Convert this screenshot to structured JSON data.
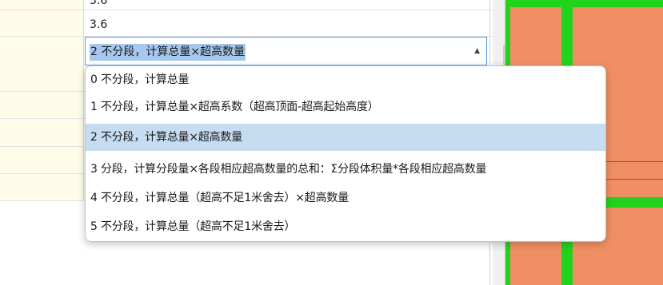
{
  "grid": {
    "top_value": "3.6",
    "value_row": "3.6",
    "combo_value": "2 不分段，计算总量×超高数量"
  },
  "dropdown": {
    "options": [
      "0 不分段，计算总量",
      "1 不分段，计算总量×超高系数（超高顶面-超高起始高度）",
      "2 不分段，计算总量×超高数量",
      "3 分段，计算分段量×各段相应超高数量的总和：Σ分段体积量*各段相应超高数量",
      "4 不分段，计算总量（超高不足1米舍去）×超高数量",
      "5 不分段，计算总量（超高不足1米舍去）"
    ],
    "selected_index": 2
  },
  "colors": {
    "selection": "#c5dcf1",
    "combo_border": "#5b9be0",
    "canvas_fill": "#f08f63",
    "canvas_lines": "#22d31c",
    "row_highlight": "#fffde9"
  }
}
